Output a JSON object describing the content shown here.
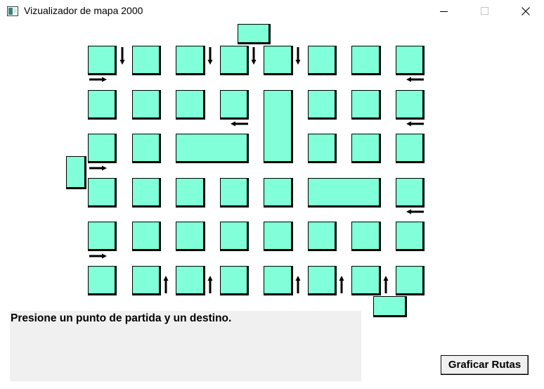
{
  "window": {
    "title": "Vizualizador de mapa 2000"
  },
  "status": {
    "message": "Presione un punto de partida y un destino."
  },
  "actions": {
    "graph_routes_label": "Graficar Rutas"
  },
  "colors": {
    "block": "#80ffd8",
    "border": "#000000",
    "panel": "#f0f0f0"
  }
}
